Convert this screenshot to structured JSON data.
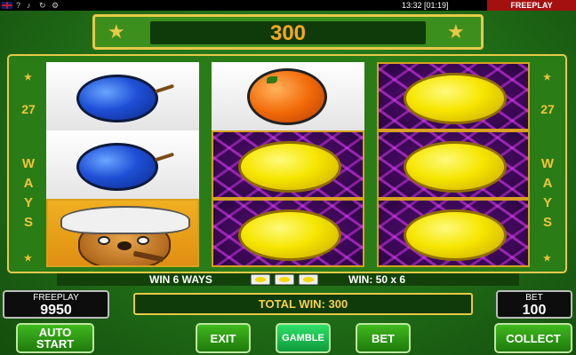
{
  "status_bar": {
    "clock": "13:32 [01:19]",
    "mode_tag": "FREEPLAY",
    "icons": [
      "uk-flag-icon",
      "help-icon",
      "sound-icon",
      "history-icon",
      "settings-icon"
    ]
  },
  "balance_display": {
    "value": "300"
  },
  "side_labels": {
    "ways_number": "27",
    "ways_word": "WAYS"
  },
  "reels": [
    [
      "plum",
      "plum",
      "beaver-wild"
    ],
    [
      "orange",
      "lemon",
      "lemon"
    ],
    [
      "lemon",
      "lemon",
      "lemon"
    ]
  ],
  "win_info": {
    "ways_text": "WIN 6 WAYS",
    "detail_text": "WIN: 50 x 6",
    "symbol_count": 3
  },
  "freeplay": {
    "label": "FREEPLAY",
    "value": "9950"
  },
  "bet": {
    "label": "BET",
    "value": "100"
  },
  "total_win": {
    "text": "TOTAL WIN: 300"
  },
  "buttons": {
    "autostart_line1": "AUTO",
    "autostart_line2": "START",
    "exit": "EXIT",
    "gamble": "GAMBLE",
    "bet": "BET",
    "collect": "COLLECT"
  },
  "colors": {
    "frame_gold": "#e8c948",
    "table_green": "#2a7c17",
    "win_orange": "#f7a81a",
    "freeplay_red": "#a40f0f"
  }
}
